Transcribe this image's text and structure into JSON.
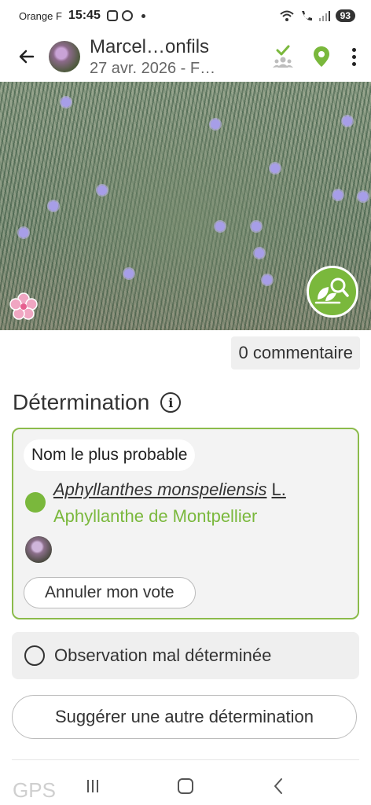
{
  "status_bar": {
    "carrier": "Orange F",
    "time": "15:45",
    "battery": "93"
  },
  "header": {
    "title": "Marcel…onfils",
    "subtitle": "27 avr. 2026 - F…",
    "back_icon": "arrow-left-icon",
    "check_icon": "check-icon",
    "group_icon": "group-icon",
    "location_icon": "location-pin-icon",
    "menu_icon": "more-vert-icon"
  },
  "photo": {
    "badge_icon": "flower-icon",
    "identify_icon": "leaf-search-icon"
  },
  "comments": {
    "label": "0 commentaire"
  },
  "determination": {
    "title": "Détermination",
    "info_icon_glyph": "i",
    "card": {
      "probable_label": "Nom le plus probable",
      "scientific_name": "Aphyllanthes monspeliensis",
      "author": "L.",
      "common_name": "Aphyllanthe de Montpellier",
      "cancel_vote_label": "Annuler mon vote"
    },
    "misdetermined_label": "Observation mal déterminée",
    "suggest_label": "Suggérer une autre détermination"
  },
  "next_section": {
    "label": "GPS"
  },
  "colors": {
    "accent_green": "#7ab83c",
    "card_border": "#8bbb4b"
  }
}
